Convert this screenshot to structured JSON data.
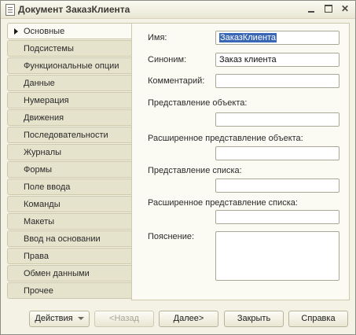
{
  "window": {
    "title": "Документ ЗаказКлиента"
  },
  "tabs": [
    {
      "label": "Основные",
      "active": true
    },
    {
      "label": "Подсистемы"
    },
    {
      "label": "Функциональные опции"
    },
    {
      "label": "Данные"
    },
    {
      "label": "Нумерация"
    },
    {
      "label": "Движения"
    },
    {
      "label": "Последовательности"
    },
    {
      "label": "Журналы"
    },
    {
      "label": "Формы"
    },
    {
      "label": "Поле ввода"
    },
    {
      "label": "Команды"
    },
    {
      "label": "Макеты"
    },
    {
      "label": "Ввод на основании"
    },
    {
      "label": "Права"
    },
    {
      "label": "Обмен данными"
    },
    {
      "label": "Прочее"
    }
  ],
  "form": {
    "name_label": "Имя:",
    "name_value": "ЗаказКлиента",
    "synonym_label": "Синоним:",
    "synonym_value": "Заказ клиента",
    "comment_label": "Комментарий:",
    "comment_value": "",
    "object_presentation_label": "Представление объекта:",
    "object_presentation_value": "",
    "ext_object_presentation_label": "Расширенное представление объекта:",
    "ext_object_presentation_value": "",
    "list_presentation_label": "Представление списка:",
    "list_presentation_value": "",
    "ext_list_presentation_label": "Расширенное представление списка:",
    "ext_list_presentation_value": "",
    "explanation_label": "Пояснение:",
    "explanation_value": ""
  },
  "buttons": {
    "actions": "Действия",
    "back": "<Назад",
    "next": "Далее>",
    "close": "Закрыть",
    "help": "Справка"
  }
}
